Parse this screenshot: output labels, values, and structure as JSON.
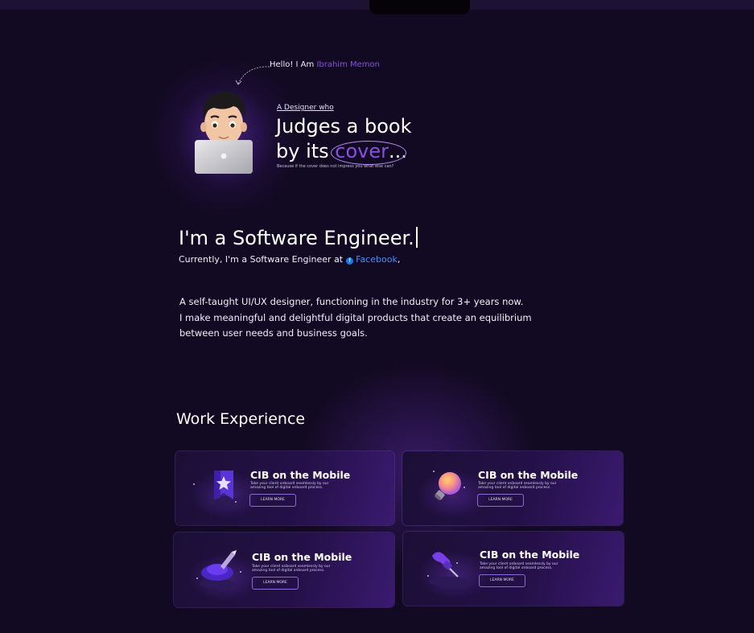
{
  "hero": {
    "hello_prefix": "Hello! I Am",
    "hello_name": "Ibrahim Memon",
    "tagline_small": "A Designer who",
    "headline_line1": "Judges a book",
    "headline_line2_prefix": "by its",
    "headline_highlight": "cover",
    "headline_suffix": "...",
    "subtext": "Because if the cover does not impress you what else can?"
  },
  "intro": {
    "role_title": "I'm a Software Engineer.",
    "currently_prefix": "Currently, I'm a Software Engineer at",
    "company": "Facebook",
    "company_suffix": ",",
    "bio_lines": [
      "A self-taught UI/UX designer, functioning in the industry for 3+ years now.",
      "I make meaningful and delightful digital products that create an equilibrium",
      "between user needs and business goals."
    ]
  },
  "work": {
    "heading": "Work Experience",
    "cards": [
      {
        "title": "CIB on the Mobile",
        "desc": "Take your client onboard seamlessly by our amazing tool of digital onboard process.",
        "button": "LEARN MORE",
        "icon": "bookmark-star-icon"
      },
      {
        "title": "CIB on the Mobile",
        "desc": "Take your client onboard seamlessly by our amazing tool of digital onboard process.",
        "button": "LEARN MORE",
        "icon": "lightbulb-icon"
      },
      {
        "title": "CIB on the Mobile",
        "desc": "Take your client onboard seamlessly by our amazing tool of digital onboard process.",
        "button": "LEARN MORE",
        "icon": "pen-tool-icon"
      },
      {
        "title": "CIB on the Mobile",
        "desc": "Take your client onboard seamlessly by our amazing tool of digital onboard process.",
        "button": "LEARN MORE",
        "icon": "push-pin-icon"
      }
    ]
  },
  "colors": {
    "background": "#120a22",
    "accent": "#8a4fe0",
    "link": "#4a8df5"
  }
}
